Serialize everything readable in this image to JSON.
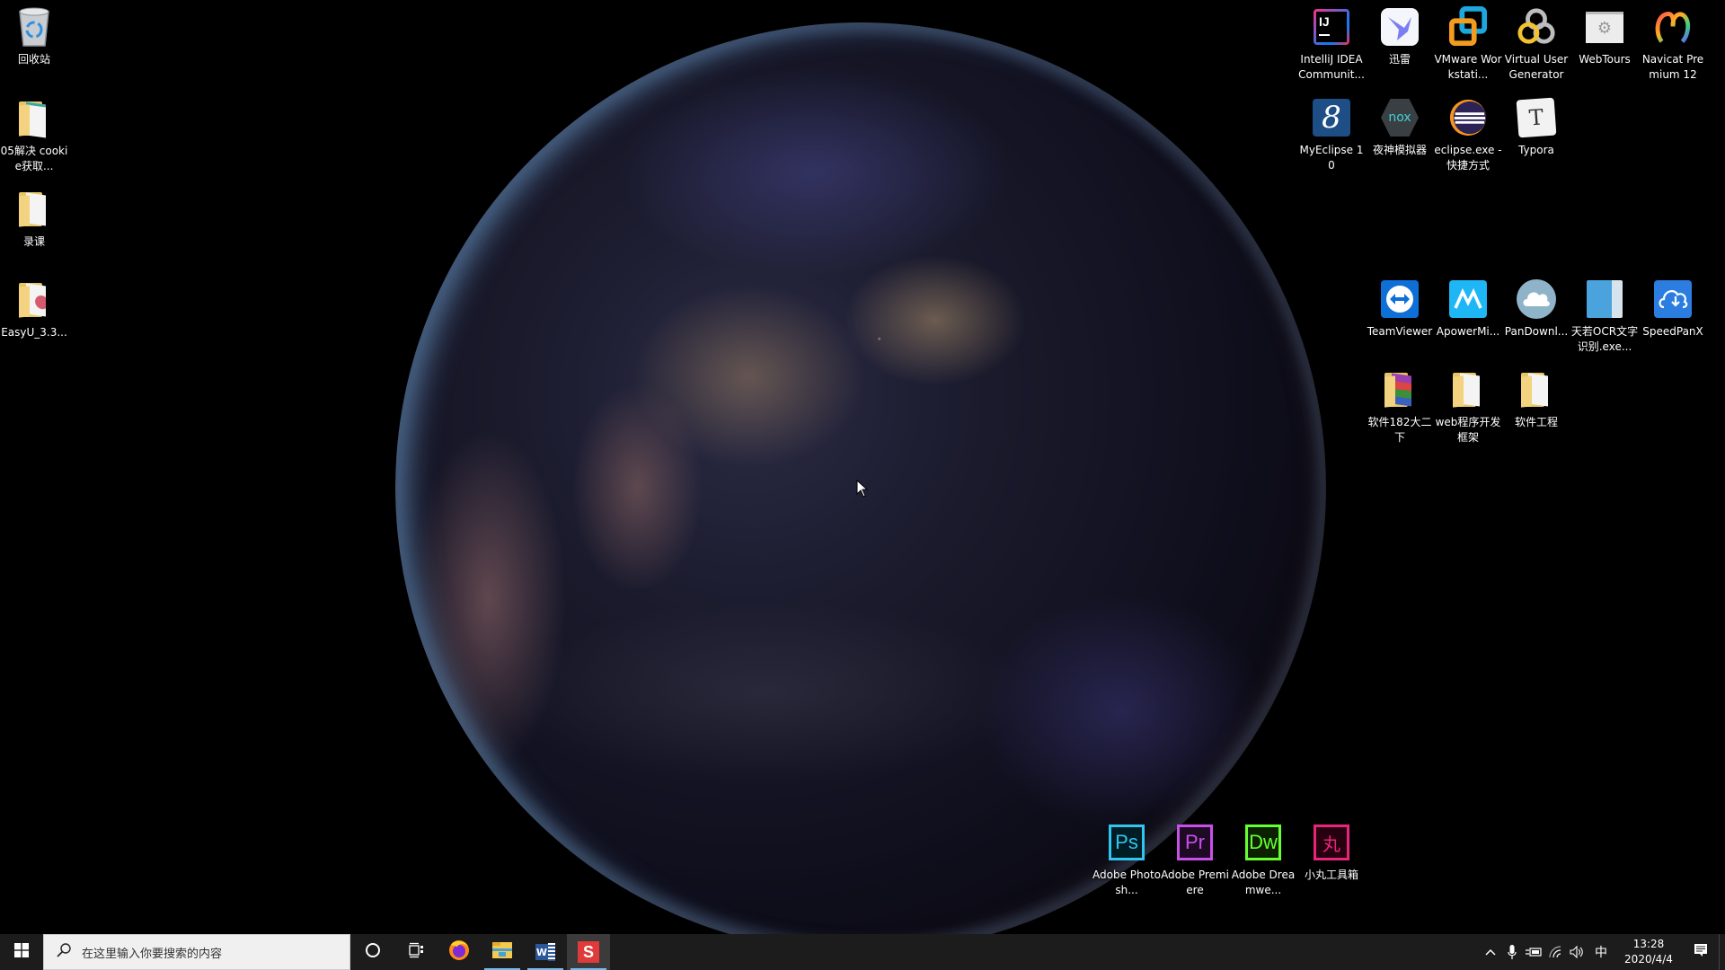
{
  "desktop": {
    "wallpaper": "earth-at-night-globe",
    "left_icons": [
      {
        "name": "recycle-bin",
        "icon": "recycle-bin-icon",
        "label": "回收站"
      },
      {
        "name": "folder-05-cookie",
        "icon": "folder-icon",
        "label": "05解决 cookie获取..."
      },
      {
        "name": "folder-lu-ke",
        "icon": "folder-icon",
        "label": "录课"
      },
      {
        "name": "folder-easyu",
        "icon": "folder-icon",
        "label": "EasyU_3.3..."
      }
    ],
    "right_icons": [
      {
        "name": "intellij-idea",
        "icon": "intellij-idea-icon",
        "label": "IntelliJ IDEA Communit..."
      },
      {
        "name": "xunlei",
        "icon": "xunlei-bird-icon",
        "label": "迅雷"
      },
      {
        "name": "vmware-workstation",
        "icon": "vmware-icon",
        "label": "VMware Workstati..."
      },
      {
        "name": "virtual-user-generator",
        "icon": "vugen-icon",
        "label": "Virtual User Generator"
      },
      {
        "name": "webtours",
        "icon": "webtours-gears-icon",
        "label": "WebTours"
      },
      {
        "name": "navicat-premium",
        "icon": "navicat-icon",
        "label": "Navicat Premium 12"
      },
      {
        "name": "myeclipse",
        "icon": "myeclipse-icon",
        "label": "MyEclipse 10"
      },
      {
        "name": "nox-emulator",
        "icon": "nox-icon",
        "label": "夜神模拟器"
      },
      {
        "name": "eclipse-shortcut",
        "icon": "eclipse-icon",
        "label": "eclipse.exe - 快捷方式"
      },
      {
        "name": "typora",
        "icon": "typora-icon",
        "label": "Typora"
      },
      {
        "name": "teamviewer",
        "icon": "teamviewer-icon",
        "label": "TeamViewer"
      },
      {
        "name": "apowermirror",
        "icon": "apowermirror-icon",
        "label": "ApowerMi..."
      },
      {
        "name": "pandownload",
        "icon": "pandownload-cloud-icon",
        "label": "PanDownl..."
      },
      {
        "name": "tianruo-ocr",
        "icon": "ocr-app-icon",
        "label": "天若OCR文字识别.exe..."
      },
      {
        "name": "speedpanx",
        "icon": "speedpanx-icon",
        "label": "SpeedPanX"
      },
      {
        "name": "folder-software-182",
        "icon": "winrar-folder-icon",
        "label": "软件182大二下"
      },
      {
        "name": "folder-web-framework",
        "icon": "folder-icon",
        "label": "web程序开发框架"
      },
      {
        "name": "folder-software-engineering",
        "icon": "folder-icon",
        "label": "软件工程"
      }
    ],
    "bottom_icons": [
      {
        "name": "adobe-photoshop",
        "icon": "photoshop-icon",
        "glyph": "Ps",
        "label": "Adobe Photosh...",
        "color": "#31c5f0"
      },
      {
        "name": "adobe-premiere",
        "icon": "premiere-icon",
        "glyph": "Pr",
        "label": "Adobe Premiere",
        "color": "#c850e8"
      },
      {
        "name": "adobe-dreamweaver",
        "icon": "dreamweaver-icon",
        "glyph": "Dw",
        "label": "Adobe Dreamwe...",
        "color": "#66ff33"
      },
      {
        "name": "xiaowan-toolbox",
        "icon": "xiaowan-icon",
        "glyph": "丸",
        "label": "小丸工具箱",
        "color": "#e8257a"
      }
    ]
  },
  "taskbar": {
    "start": "windows-start-icon",
    "search_placeholder": "在这里输入你要搜索的内容",
    "cortana": "cortana-circle-icon",
    "task_view": "task-view-icon",
    "pinned": [
      {
        "name": "firefox",
        "icon": "firefox-icon",
        "active": false
      },
      {
        "name": "file-explorer",
        "icon": "file-explorer-icon",
        "active": true
      },
      {
        "name": "word",
        "icon": "word-icon",
        "glyph": "W",
        "active": true
      },
      {
        "name": "screen-recorder",
        "icon": "s-app-icon",
        "glyph": "S",
        "active": true,
        "selected": true
      }
    ],
    "tray": {
      "chevron": "^",
      "ime": "中",
      "time": "13:28",
      "date": "2020/4/4"
    }
  },
  "colors": {
    "taskbar_bg": "#1c1c1c",
    "active_indicator": "#76b9ed",
    "folder": "#e8c666"
  }
}
